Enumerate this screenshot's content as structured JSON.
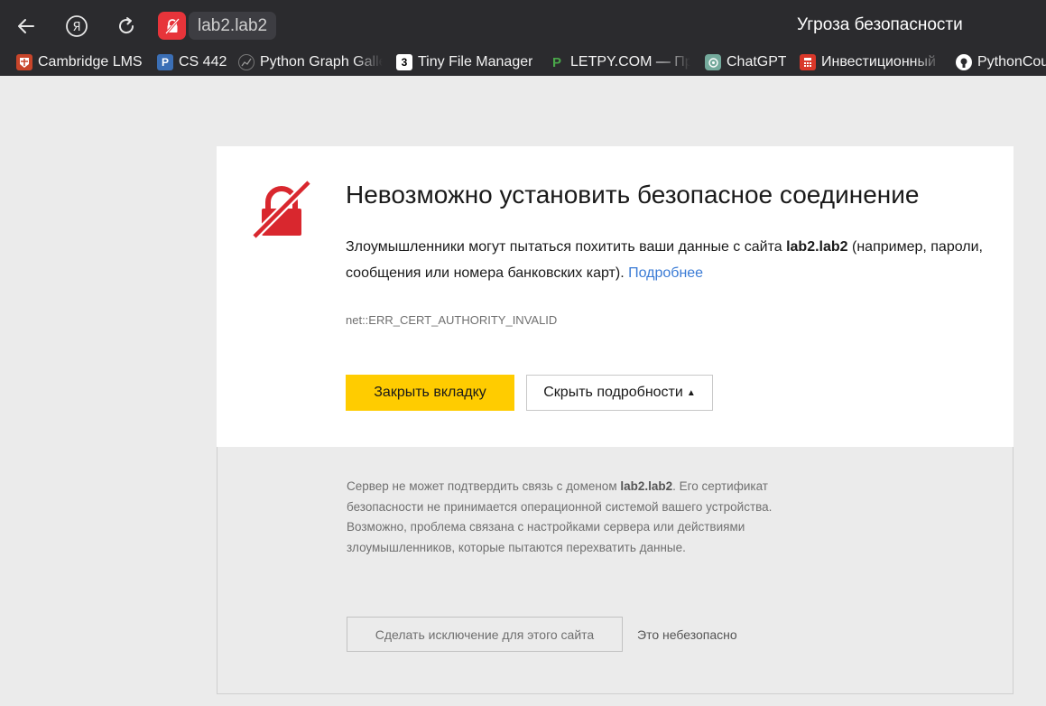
{
  "browser": {
    "address": "lab2.lab2",
    "tab_title": "Угроза безопасности"
  },
  "bookmarks": [
    {
      "label": "Cambridge LMS",
      "icon": "cambridge-crest-icon",
      "color": "#c8452a"
    },
    {
      "label": "CS 442",
      "icon": "prairielearn-icon",
      "color": "#3b6fb6"
    },
    {
      "label": "Python Graph Gallery",
      "icon": "graph-gallery-icon",
      "color": "#555555"
    },
    {
      "label": "Tiny File Manager",
      "icon": "tfm-icon",
      "color": "#111111"
    },
    {
      "label": "LETPY.COM — Программирование",
      "icon": "letpy-icon",
      "color": "#3b8f3b"
    },
    {
      "label": "ChatGPT",
      "icon": "chatgpt-icon",
      "color": "#74aa9c"
    },
    {
      "label": "Инвестиционный",
      "icon": "calculator-icon",
      "color": "#d9382a"
    },
    {
      "label": "PythonCourse",
      "icon": "github-icon",
      "color": "#ffffff"
    }
  ],
  "error": {
    "heading": "Невозможно установить безопасное соединение",
    "desc_before": "Злоумышленники могут пытаться похитить ваши данные с сайта ",
    "desc_host": "lab2.lab2",
    "desc_after": " (например, пароли, сообщения или номера банковских карт). ",
    "more_link": "Подробнее",
    "code": "net::ERR_CERT_AUTHORITY_INVALID",
    "close_button": "Закрыть вкладку",
    "details_button": "Скрыть подробности",
    "details_before": "Сервер не может подтвердить связь с доменом ",
    "details_host": "lab2.lab2",
    "details_after": ". Его сертификат безопасности не принимается операционной системой вашего устройства. Возможно, проблема связана с настройками сервера или действиями злоумышленников, которые пытаются перехватить данные.",
    "exception_button": "Сделать исключение для этого сайта",
    "unsafe_label": "Это небезопасно",
    "accent_color": "#ffcc00",
    "danger_color": "#d9272e"
  }
}
